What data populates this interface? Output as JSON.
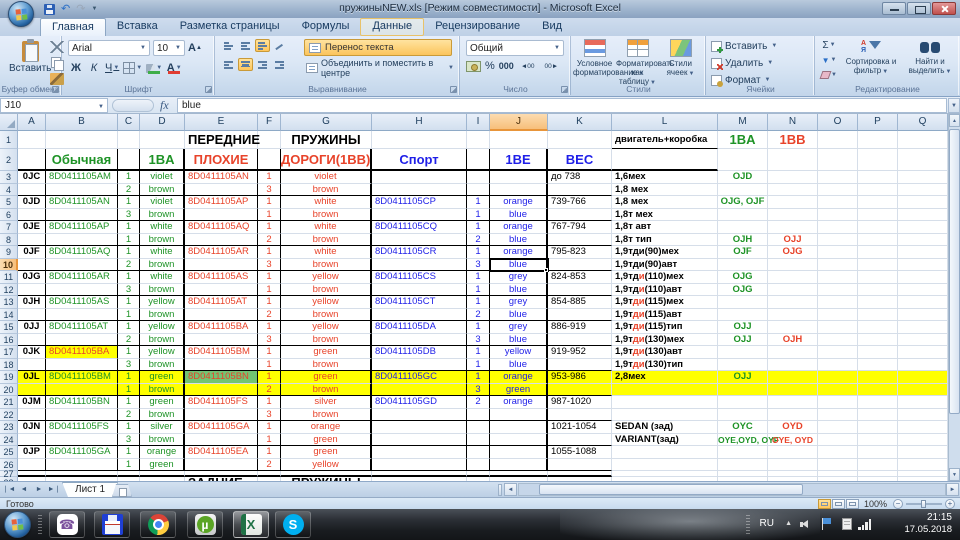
{
  "window": {
    "title": "пружиныNEW.xls [Режим совместимости] - Microsoft Excel"
  },
  "ribbon": {
    "tabs": [
      {
        "label": "Главная",
        "state": "active"
      },
      {
        "label": "Вставка"
      },
      {
        "label": "Разметка страницы"
      },
      {
        "label": "Формулы"
      },
      {
        "label": "Данные",
        "state": "hover"
      },
      {
        "label": "Рецензирование"
      },
      {
        "label": "Вид"
      }
    ],
    "clipboard": {
      "group": "Буфер обмена",
      "paste": "Вставить"
    },
    "font": {
      "group": "Шрифт",
      "name": "Arial",
      "size": "10",
      "bold": "Ж",
      "italic": "К",
      "underline": "Ч"
    },
    "alignment": {
      "group": "Выравнивание",
      "wrap": "Перенос текста",
      "merge": "Объединить и поместить в центре"
    },
    "number": {
      "group": "Число",
      "format": "Общий",
      "percent": "%",
      "thousands": "000"
    },
    "styles": {
      "group": "Стили",
      "conditional": "Условное форматирование",
      "format_table": "Форматировать как таблицу",
      "cell_styles": "Стили ячеек"
    },
    "cells": {
      "group": "Ячейки",
      "insert": "Вставить",
      "delete": "Удалить",
      "format": "Формат"
    },
    "editing": {
      "group": "Редактирование",
      "sort": "Сортировка и фильтр",
      "find": "Найти и выделить"
    }
  },
  "formula_bar": {
    "name_box": "J10",
    "fx_label": "fx",
    "value": "blue"
  },
  "grid": {
    "selected": "J10",
    "columns": [
      "A",
      "B",
      "C",
      "D",
      "E",
      "F",
      "G",
      "H",
      "I",
      "J",
      "K",
      "L",
      "M",
      "N",
      "O",
      "P",
      "Q"
    ],
    "col_widths": {
      "A": 28,
      "B": 72,
      "C": 22,
      "D": 45,
      "E": 73,
      "F": 23,
      "G": 91,
      "H": 95,
      "I": 23,
      "J": 58,
      "K": 64,
      "L": 106,
      "M": 50,
      "N": 50,
      "O": 40,
      "P": 40,
      "Q": 50
    },
    "col_defaults": {
      "A": {
        "c": "k",
        "b": 1,
        "al": "c"
      },
      "B": {
        "c": "g",
        "al": "l"
      },
      "C": {
        "c": "g",
        "al": "c"
      },
      "D": {
        "c": "g",
        "al": "c"
      },
      "E": {
        "c": "r",
        "al": "l"
      },
      "F": {
        "c": "r",
        "al": "c"
      },
      "G": {
        "c": "r",
        "al": "c"
      },
      "H": {
        "c": "b",
        "al": "l"
      },
      "I": {
        "c": "b",
        "al": "c"
      },
      "J": {
        "c": "b",
        "al": "c"
      },
      "K": {
        "c": "k",
        "al": "l"
      },
      "L": {
        "c": "k",
        "b": 1,
        "al": "l"
      },
      "M": {
        "c": "g",
        "b": 1,
        "al": "c"
      },
      "N": {
        "c": "r",
        "b": 1,
        "al": "c"
      },
      "O": {
        "al": "c"
      },
      "P": {
        "al": "c"
      },
      "Q": {
        "al": "c"
      }
    },
    "colors": {
      "k": "#000000",
      "g": "#1e9326",
      "r": "#e8432a",
      "b": "#1f1fe8"
    },
    "backgrounds": {
      "y": "#ffff00",
      "gn": "#72c472"
    },
    "rows": [
      {
        "n": 1,
        "h": 18,
        "cells": {
          "E": {
            "t": "ПЕРЕДНИЕ",
            "c": "k",
            "b": 1,
            "fs": 13
          },
          "G": {
            "t": "ПРУЖИНЫ",
            "c": "k",
            "b": 1,
            "fs": 13
          },
          "L": {
            "t": "двигатель+коробка"
          },
          "M": {
            "t": "1BA",
            "fs": 13
          },
          "N": {
            "t": "1BB",
            "fs": 13
          }
        }
      },
      {
        "n": 2,
        "h": 22,
        "cells": {
          "B": {
            "t": "Обычная",
            "b": 1,
            "fs": 13,
            "al": "c"
          },
          "D": {
            "t": "1BA",
            "b": 1,
            "fs": 13
          },
          "E": {
            "t": "ПЛОХИЕ",
            "b": 1,
            "fs": 13,
            "al": "c"
          },
          "G": {
            "t": "ДОРОГИ(1BB)",
            "b": 1,
            "fs": 13
          },
          "H": {
            "t": "Спорт",
            "b": 1,
            "fs": 13,
            "al": "c"
          },
          "J": {
            "t": "1BE",
            "b": 1,
            "fs": 13
          },
          "K": {
            "t": "ВЕС",
            "c": "b",
            "b": 1,
            "fs": 13,
            "al": "c"
          }
        }
      },
      {
        "n": 3,
        "cells": {
          "A": "0JC",
          "B": "8D0411105AM",
          "C": "1",
          "D": "violet",
          "E": "8D0411105AN",
          "F": "1",
          "G": "violet",
          "K": "до 738",
          "L": "1,6мех",
          "M": "OJD"
        }
      },
      {
        "n": 4,
        "cells": {
          "C": "2",
          "D": "brown",
          "F": "3",
          "G": "brown",
          "L": "1,8 мех"
        }
      },
      {
        "n": 5,
        "cells": {
          "A": "0JD",
          "B": "8D0411105AN",
          "C": "1",
          "D": "violet",
          "E": "8D0411105AP",
          "F": "1",
          "G": "white",
          "H": "8D0411105CP",
          "I": "1",
          "J": "orange",
          "K": "739-766",
          "L": "1,8 мех",
          "M": "OJG, OJF"
        }
      },
      {
        "n": 6,
        "cells": {
          "C": "3",
          "D": "brown",
          "F": "1",
          "G": "brown",
          "I": "1",
          "J": "blue",
          "L": "1,8т мех"
        }
      },
      {
        "n": 7,
        "cells": {
          "A": "0JE",
          "B": "8D0411105AP",
          "C": "1",
          "D": "white",
          "E": "8D0411105AQ",
          "F": "1",
          "G": "white",
          "H": "8D0411105CQ",
          "I": "1",
          "J": "orange",
          "K": "767-794",
          "L": "1,8т авт"
        }
      },
      {
        "n": 8,
        "cells": {
          "C": "1",
          "D": "brown",
          "F": "2",
          "G": "brown",
          "I": "2",
          "J": "blue",
          "L": "1,8т тип",
          "M": "OJH",
          "N": "OJJ"
        }
      },
      {
        "n": 9,
        "cells": {
          "A": "0JF",
          "B": "8D0411105AQ",
          "C": "1",
          "D": "white",
          "E": "8D0411105AR",
          "F": "1",
          "G": "white",
          "H": "8D0411105CR",
          "I": "1",
          "J": "orange",
          "K": "795-823",
          "L": "1,9тди(90)мех",
          "M": "OJF",
          "N": "OJG"
        }
      },
      {
        "n": 10,
        "cells": {
          "C": "2",
          "D": "brown",
          "F": "3",
          "G": "brown",
          "I": "3",
          "J": {
            "t": "blue",
            "sel": 1
          },
          "L": "1,9тди(90)авт"
        }
      },
      {
        "n": 11,
        "cells": {
          "A": "0JG",
          "B": "8D0411105AR",
          "C": "1",
          "D": "white",
          "E": "8D0411105AS",
          "F": "1",
          "G": "yellow",
          "H": "8D0411105CS",
          "I": "1",
          "J": "grey",
          "K": "824-853",
          "L": {
            "p": [
              [
                "1,9тд",
                "k"
              ],
              [
                "и",
                "r"
              ],
              [
                "(110)мех",
                "k"
              ]
            ]
          },
          "M": "OJG"
        }
      },
      {
        "n": 12,
        "cells": {
          "C": "3",
          "D": "brown",
          "F": "1",
          "G": "brown",
          "I": "1",
          "J": "blue",
          "L": {
            "p": [
              [
                "1,9тд",
                "k"
              ],
              [
                "и",
                "r"
              ],
              [
                "(110)авт",
                "k"
              ]
            ]
          },
          "M": "OJG"
        }
      },
      {
        "n": 13,
        "cells": {
          "A": "0JH",
          "B": "8D0411105AS",
          "C": "1",
          "D": "yellow",
          "E": "8D0411105AT",
          "F": "1",
          "G": "yellow",
          "H": "8D0411105CT",
          "I": "1",
          "J": "grey",
          "K": "854-885",
          "L": {
            "p": [
              [
                "1,9т",
                "k"
              ],
              [
                "ди",
                "r"
              ],
              [
                "(115)мех",
                "k"
              ]
            ]
          }
        }
      },
      {
        "n": 14,
        "cells": {
          "C": "1",
          "D": "brown",
          "F": "2",
          "G": "brown",
          "I": "2",
          "J": "blue",
          "L": {
            "p": [
              [
                "1,9т",
                "k"
              ],
              [
                "ди",
                "r"
              ],
              [
                "(115)авт",
                "k"
              ]
            ]
          }
        }
      },
      {
        "n": 15,
        "cells": {
          "A": "0JJ",
          "B": "8D0411105AT",
          "C": "1",
          "D": "yellow",
          "E": "8D0411105BA",
          "F": "1",
          "G": "yellow",
          "H": "8D0411105DA",
          "I": "1",
          "J": "grey",
          "K": "886-919",
          "L": {
            "p": [
              [
                "1,9т",
                "k"
              ],
              [
                "ди",
                "r"
              ],
              [
                "(115)тип",
                "k"
              ]
            ]
          },
          "M": "OJJ"
        }
      },
      {
        "n": 16,
        "cells": {
          "C": "2",
          "D": "brown",
          "F": "3",
          "G": "brown",
          "I": "3",
          "J": "blue",
          "L": {
            "p": [
              [
                "1,9т",
                "k"
              ],
              [
                "ди",
                "r"
              ],
              [
                "(130)мех",
                "k"
              ]
            ]
          },
          "M": "OJJ",
          "N": "OJH"
        }
      },
      {
        "n": 17,
        "cells": {
          "A": "0JK",
          "B": {
            "t": "8D0411105BA",
            "c": "r",
            "bg": "y"
          },
          "C": "1",
          "D": "yellow",
          "E": "8D0411105BM",
          "F": "1",
          "G": "green",
          "H": "8D0411105DB",
          "I": "1",
          "J": "yellow",
          "K": "919-952",
          "L": {
            "p": [
              [
                "1,9т",
                "k"
              ],
              [
                "ди",
                "r"
              ],
              [
                "(130)авт",
                "k"
              ]
            ]
          }
        }
      },
      {
        "n": 18,
        "cells": {
          "C": "3",
          "D": "brown",
          "F": "1",
          "G": "brown",
          "I": "1",
          "J": "blue",
          "L": {
            "p": [
              [
                "1,9т",
                "k"
              ],
              [
                "ди",
                "r"
              ],
              [
                "(130)тип",
                "k"
              ]
            ]
          }
        }
      },
      {
        "n": 19,
        "bg": "y",
        "cells": {
          "A": "0JL",
          "B": "8D0411105BM",
          "C": "1",
          "D": "green",
          "E": {
            "t": "8D0411105BN",
            "bg": "gn"
          },
          "F": "1",
          "G": "green",
          "H": "8D0411105GC",
          "I": "1",
          "J": "orange",
          "K": "953-986",
          "L": "2,8мех",
          "M": "OJJ"
        }
      },
      {
        "n": 20,
        "bg": "y",
        "cells": {
          "C": "1",
          "D": "brown",
          "F": "2",
          "G": "brown",
          "I": "3",
          "J": "green"
        }
      },
      {
        "n": 21,
        "cells": {
          "A": "0JM",
          "B": "8D0411105BN",
          "C": "1",
          "D": "green",
          "E": "8D0411105FS",
          "F": "1",
          "G": "silver",
          "H": "8D0411105GD",
          "I": "2",
          "J": "orange",
          "K": "987-1020"
        }
      },
      {
        "n": 22,
        "cells": {
          "C": "2",
          "D": "brown",
          "F": "3",
          "G": "brown"
        }
      },
      {
        "n": 23,
        "cells": {
          "A": "0JN",
          "B": "8D0411105FS",
          "C": "1",
          "D": "silver",
          "E": "8D0411105GA",
          "F": "1",
          "G": "orange",
          "K": "1021-1054",
          "L": "SEDAN (зад)",
          "M": "OYC",
          "N": "OYD"
        }
      },
      {
        "n": 24,
        "cells": {
          "C": "3",
          "D": "brown",
          "F": "1",
          "G": "green",
          "L": "VARIANT(зад)",
          "M": {
            "t": "OYE,OYD, OYF",
            "fs": 8.5
          },
          "N": {
            "t": "OYE, OYD",
            "fs": 8.5
          }
        }
      },
      {
        "n": 25,
        "cells": {
          "A": "0JP",
          "B": "8D0411105GA",
          "C": "1",
          "D": "orange",
          "E": "8D0411105EA",
          "F": "1",
          "G": "green",
          "K": "1055-1088"
        }
      },
      {
        "n": 26,
        "cells": {
          "C": "1",
          "D": "green",
          "F": "2",
          "G": "yellow"
        }
      },
      {
        "n": 27,
        "h": 6,
        "cells": {}
      },
      {
        "n": 28,
        "h": 12,
        "cells": {
          "E": {
            "t": "ЗАДНИЕ",
            "c": "k",
            "b": 1,
            "fs": 13
          },
          "G": {
            "t": "ПРУЖИНЫ",
            "c": "k",
            "b": 1,
            "fs": 13
          }
        }
      }
    ]
  },
  "sheet_tabs": {
    "active": "Лист 1"
  },
  "status_bar": {
    "ready": "Готово",
    "zoom": "100%"
  },
  "taskbar": {
    "tray": {
      "lang": "RU",
      "time": "21:15",
      "date": "17.05.2018"
    }
  }
}
